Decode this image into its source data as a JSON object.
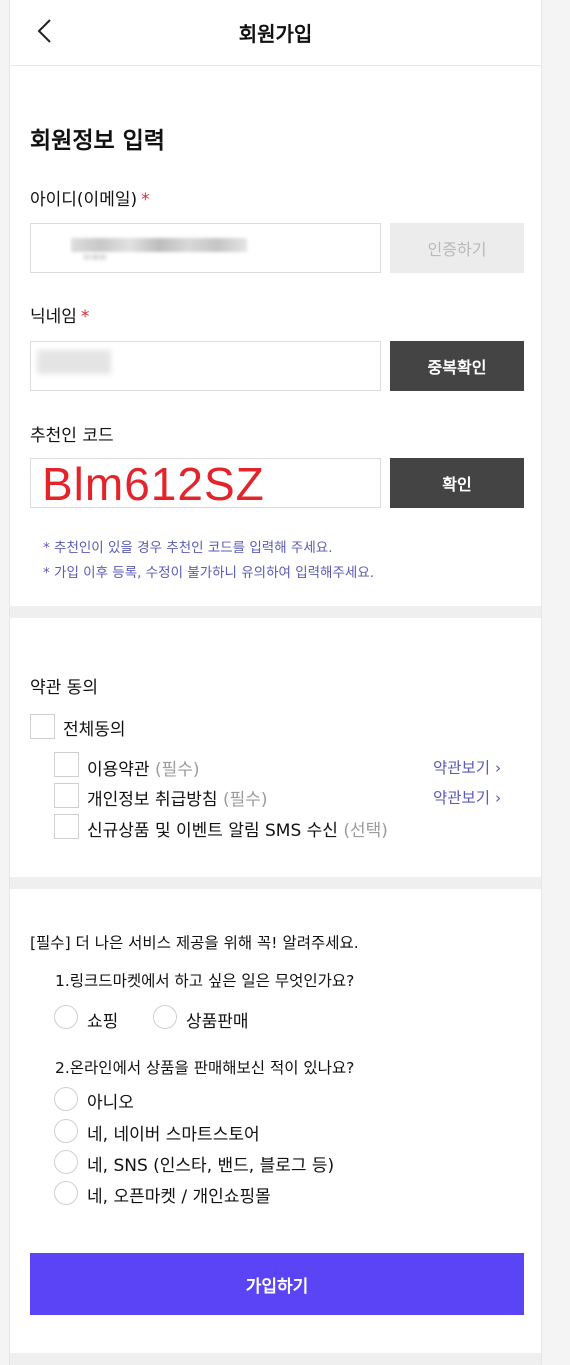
{
  "header": {
    "title": "회원가입",
    "back_icon": "chevron-left-icon"
  },
  "form": {
    "section_title": "회원정보 입력",
    "required_mark": "*",
    "id_label": "아이디(이메일)",
    "verify_button": "인증하기",
    "nickname_label": "닉네임",
    "duplicate_check_button": "중복확인",
    "referral_label": "추천인 코드",
    "referral_value": "Blm612SZ",
    "confirm_button": "확인",
    "notes": [
      "* 추천인이 있을 경우 추천인 코드를 입력해 주세요.",
      "* 가입 이후 등록, 수정이 불가하니 유의하여 입력해주세요."
    ]
  },
  "terms": {
    "title": "약관 동의",
    "all_agree": "전체동의",
    "items": [
      {
        "label": "이용약관",
        "tag": "(필수)",
        "link": "약관보기 ›"
      },
      {
        "label": "개인정보 취급방침",
        "tag": "(필수)",
        "link": "약관보기 ›"
      },
      {
        "label": "신규상품 및 이벤트 알림 SMS 수신",
        "tag": "(선택)"
      }
    ]
  },
  "survey": {
    "header": "[필수] 더 나은 서비스 제공을 위해 꼭! 알려주세요.",
    "q1": {
      "question": "1.링크드마켓에서 하고 싶은 일은 무엇인가요?",
      "options": [
        "쇼핑",
        "상품판매"
      ]
    },
    "q2": {
      "question": "2.온라인에서 상품을 판매해보신 적이 있나요?",
      "options": [
        "아니오",
        "네, 네이버 스마트스토어",
        "네, SNS (인스타, 밴드, 블로그 등)",
        "네, 오픈마켓 / 개인쇼핑몰"
      ]
    }
  },
  "submit_button": "가입하기",
  "colors": {
    "accent": "#5b43f6",
    "required": "#e0263a",
    "link": "#5a5ab8",
    "dark_button": "#444444"
  }
}
